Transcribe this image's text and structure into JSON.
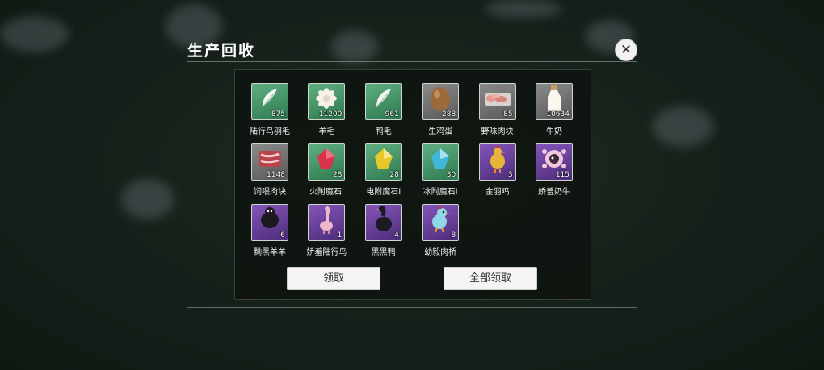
{
  "panel": {
    "title": "生产回收",
    "claim_label": "领取",
    "claim_all_label": "全部领取"
  },
  "items": [
    {
      "name": "陆行鸟羽毛",
      "count": "875",
      "icon": "feather-icon",
      "bg": "green"
    },
    {
      "name": "羊毛",
      "count": "11200",
      "icon": "wool-icon",
      "bg": "green"
    },
    {
      "name": "鸭毛",
      "count": "961",
      "icon": "feather-icon",
      "bg": "green"
    },
    {
      "name": "生鸡蛋",
      "count": "288",
      "icon": "egg-icon",
      "bg": "grey"
    },
    {
      "name": "野味肉块",
      "count": "85",
      "icon": "meat-tray-icon",
      "bg": "grey"
    },
    {
      "name": "牛奶",
      "count": "10634",
      "icon": "milk-bottle-icon",
      "bg": "grey"
    },
    {
      "name": "饲喂肉块",
      "count": "1148",
      "icon": "meat-slab-icon",
      "bg": "grey"
    },
    {
      "name": "火附魔石l",
      "count": "28",
      "icon": "fire-crystal-icon",
      "bg": "green"
    },
    {
      "name": "电附魔石l",
      "count": "28",
      "icon": "lightning-crystal-icon",
      "bg": "green"
    },
    {
      "name": "冰附魔石l",
      "count": "30",
      "icon": "ice-crystal-icon",
      "bg": "green"
    },
    {
      "name": "金羽鸡",
      "count": "3",
      "icon": "golden-chicken-icon",
      "bg": "purple"
    },
    {
      "name": "娇羞奶牛",
      "count": "115",
      "icon": "shy-cow-icon",
      "bg": "purple"
    },
    {
      "name": "黝黑羊羊",
      "count": "6",
      "icon": "black-sheep-icon",
      "bg": "purple"
    },
    {
      "name": "娇羞陆行鸟",
      "count": "1",
      "icon": "pink-bird-icon",
      "bg": "purple"
    },
    {
      "name": "黑黑鸭",
      "count": "4",
      "icon": "black-duck-icon",
      "bg": "purple"
    },
    {
      "name": "幼毅肉桥",
      "count": "8",
      "icon": "blue-chick-icon",
      "bg": "purple"
    }
  ],
  "colors": {
    "green_slot": "#3f8f62",
    "grey_slot": "#6e6e6e",
    "purple_slot": "#6a40a0",
    "fire": "#d8344a",
    "lightning": "#e6c82a",
    "ice": "#3fb8d8"
  }
}
